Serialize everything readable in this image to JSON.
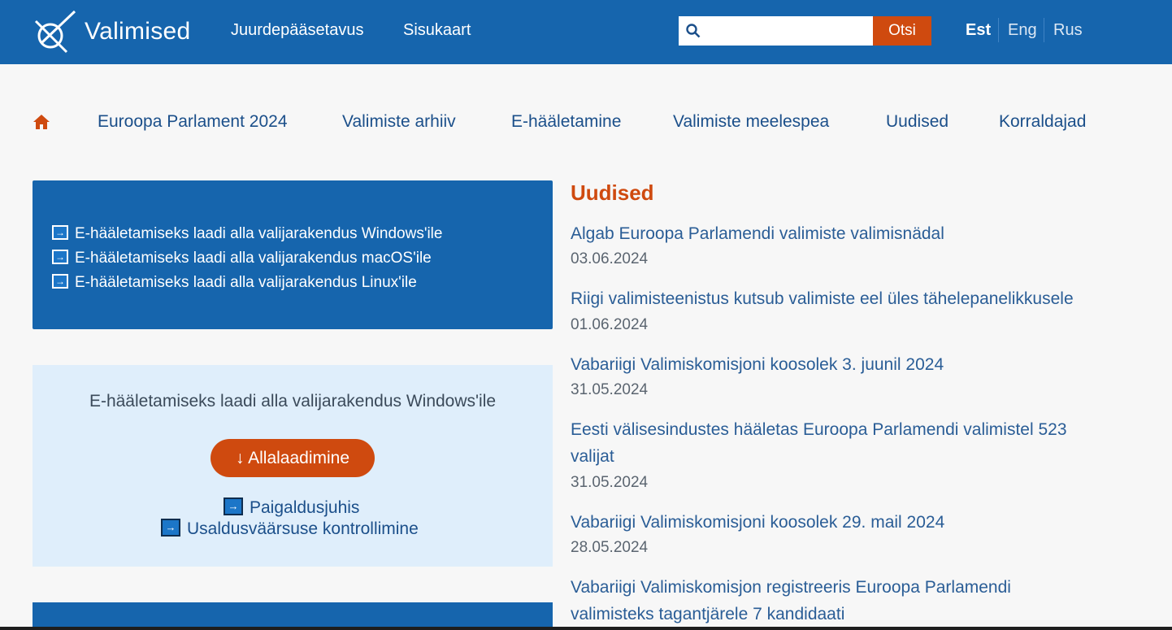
{
  "header": {
    "logo_text": "Valimised",
    "links": [
      "Juurdepääsetavus",
      "Sisukaart"
    ],
    "search": {
      "placeholder": "",
      "button_label": "Otsi"
    },
    "languages": [
      {
        "label": "Est",
        "active": true
      },
      {
        "label": "Eng",
        "active": false
      },
      {
        "label": "Rus",
        "active": false
      }
    ]
  },
  "nav": {
    "home_icon": "home-icon",
    "items": [
      "Euroopa Parlament 2024",
      "Valimiste arhiiv",
      "E-hääletamine",
      "Valimiste meelespea",
      "Uudised",
      "Korraldajad"
    ]
  },
  "downloads": {
    "links": [
      "E-hääletamiseks laadi alla valijarakendus Windows'ile",
      "E-hääletamiseks laadi alla valijarakendus macOS'ile",
      "E-hääletamiseks laadi alla valijarakendus Linux'ile"
    ]
  },
  "windows_panel": {
    "title": "E-hääletamiseks laadi alla valijarakendus Windows'ile",
    "button_label": "↓ Allalaadimine",
    "links": [
      "Paigaldusjuhis",
      "Usaldusväärsuse kontrollimine"
    ]
  },
  "news": {
    "heading": "Uudised",
    "items": [
      {
        "title": "Algab Euroopa Parlamendi valimiste valimisnädal",
        "date": "03.06.2024"
      },
      {
        "title": "Riigi valimisteenistus kutsub valimiste eel üles tähelepanelikkusele",
        "date": "01.06.2024"
      },
      {
        "title": "Vabariigi Valimiskomisjoni koosolek 3. juunil 2024",
        "date": "31.05.2024"
      },
      {
        "title": "Eesti välisesindustes hääletas Euroopa Parlamendi valimistel 523 valijat",
        "date": "31.05.2024"
      },
      {
        "title": "Vabariigi Valimiskomisjoni koosolek 29. mail 2024",
        "date": "28.05.2024"
      },
      {
        "title": "Vabariigi Valimiskomisjon registreeris Euroopa Parlamendi valimisteks tagantjärele 7 kandidaati",
        "date": ""
      }
    ]
  },
  "colors": {
    "primary": "#1665ad",
    "accent": "#cf4a0f",
    "light_panel": "#dfeefb",
    "background": "#f7f7f7"
  }
}
